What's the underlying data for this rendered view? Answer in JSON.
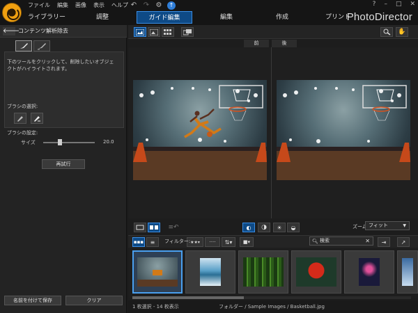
{
  "menu": [
    "ファイル",
    "編集",
    "画像",
    "表示",
    "ヘルプ"
  ],
  "window_controls": [
    "?",
    "–",
    "□",
    "✕"
  ],
  "mode_tabs": [
    {
      "label": "ライブラリー"
    },
    {
      "label": "調整"
    },
    {
      "label": "ガイド編集",
      "active": true
    },
    {
      "label": "編集"
    },
    {
      "label": "作成"
    },
    {
      "label": "プリント"
    }
  ],
  "brand": "PhotoDirector",
  "left_panel": {
    "title": "コンテンツ解析除去",
    "description": "下のツールをクリックして、削除したいオブジェクトがハイライトされます。",
    "brush_select_label": "ブラシの選択:",
    "brush_settings_label": "ブラシの設定:",
    "size_label": "サイズ",
    "size_value": "20.0",
    "size_fraction": 0.32,
    "retry_button": "再試行",
    "save_as_button": "名前を付けて保存",
    "clear_button": "クリア"
  },
  "compare": {
    "before": "前",
    "after": "後"
  },
  "zoom": {
    "label": "ズーム:",
    "value": "フィット"
  },
  "filter": {
    "label": "フィルター:",
    "search_placeholder": "検索"
  },
  "status": {
    "selection": "1 枚選択 - 14 枚表示",
    "path": "フォルダー / Sample Images / Basketball.jpg"
  },
  "colors": {
    "accent": "#3a8ee6",
    "active_tab_bg": "#0e4a86",
    "panel_bg": "#232323"
  }
}
